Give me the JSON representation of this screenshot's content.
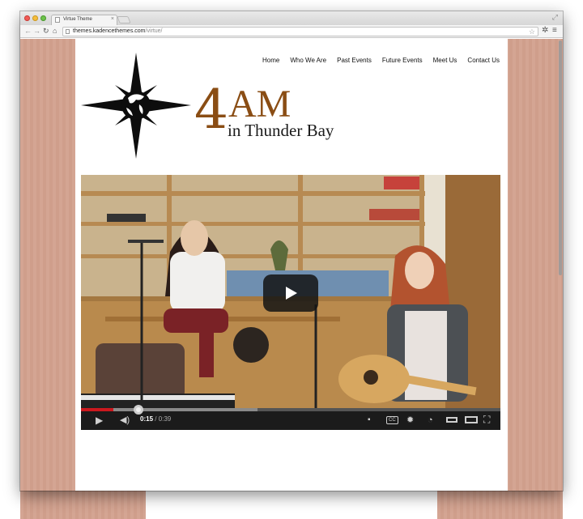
{
  "browser": {
    "tab_title": "Virtue Theme",
    "url_host": "themes.kadencethemes.com",
    "url_path": "/virtue/",
    "icons": [
      "back-icon",
      "forward-icon",
      "reload-icon",
      "home-icon",
      "star-icon",
      "extension-icon",
      "menu-icon"
    ]
  },
  "site": {
    "nav": [
      "Home",
      "Who We Are",
      "Past Events",
      "Future Events",
      "Meet Us",
      "Contact Us"
    ],
    "logo": {
      "numeral": "4",
      "letters": "AM",
      "subtitle": "in Thunder Bay",
      "accent_color": "#8a4d14"
    }
  },
  "video": {
    "current_time": "0:15",
    "duration": "0:39",
    "played_fraction": 0.0769,
    "buffered_fraction": 0.42,
    "controls": [
      "play-icon",
      "volume-icon",
      "comment-icon",
      "cc-icon",
      "settings-icon",
      "watch-later-icon",
      "small-player-icon",
      "large-player-icon",
      "fullscreen-icon"
    ]
  }
}
